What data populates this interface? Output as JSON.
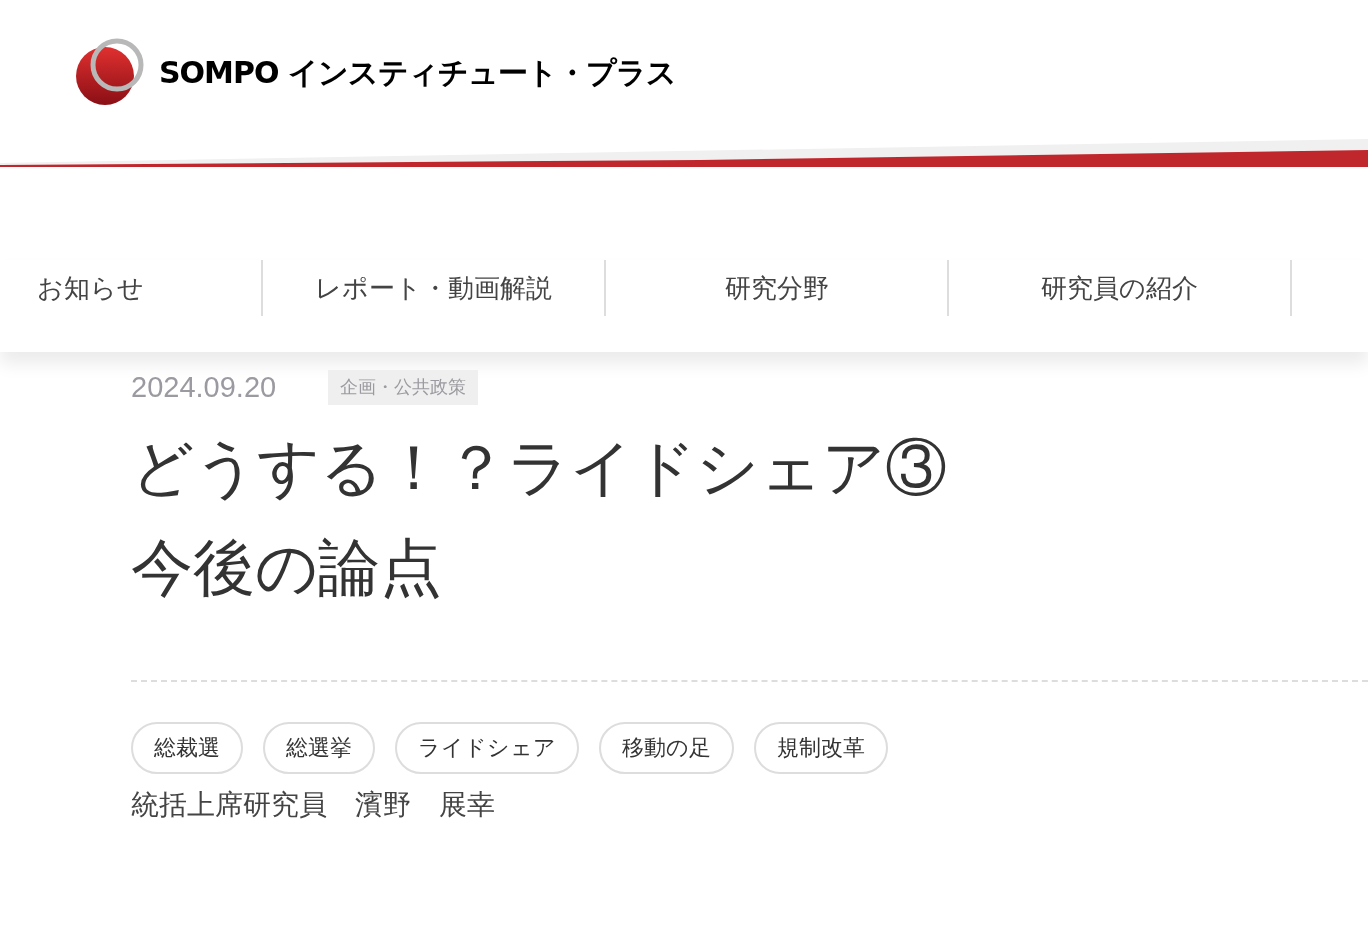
{
  "header": {
    "logo_text": "SOMPO インスティチュート・プラス"
  },
  "nav": [
    {
      "label": "お知らせ"
    },
    {
      "label": "レポート・動画解説"
    },
    {
      "label": "研究分野"
    },
    {
      "label": "研究員の紹介"
    }
  ],
  "article": {
    "date": "2024.09.20",
    "category": "企画・公共政策",
    "title_lines": [
      "どうする！？ライドシェア③",
      "今後の論点"
    ],
    "tags": [
      "総裁選",
      "総選挙",
      "ライドシェア",
      "移動の足",
      "規制改革"
    ],
    "author": "統括上席研究員　濱野　展幸"
  }
}
